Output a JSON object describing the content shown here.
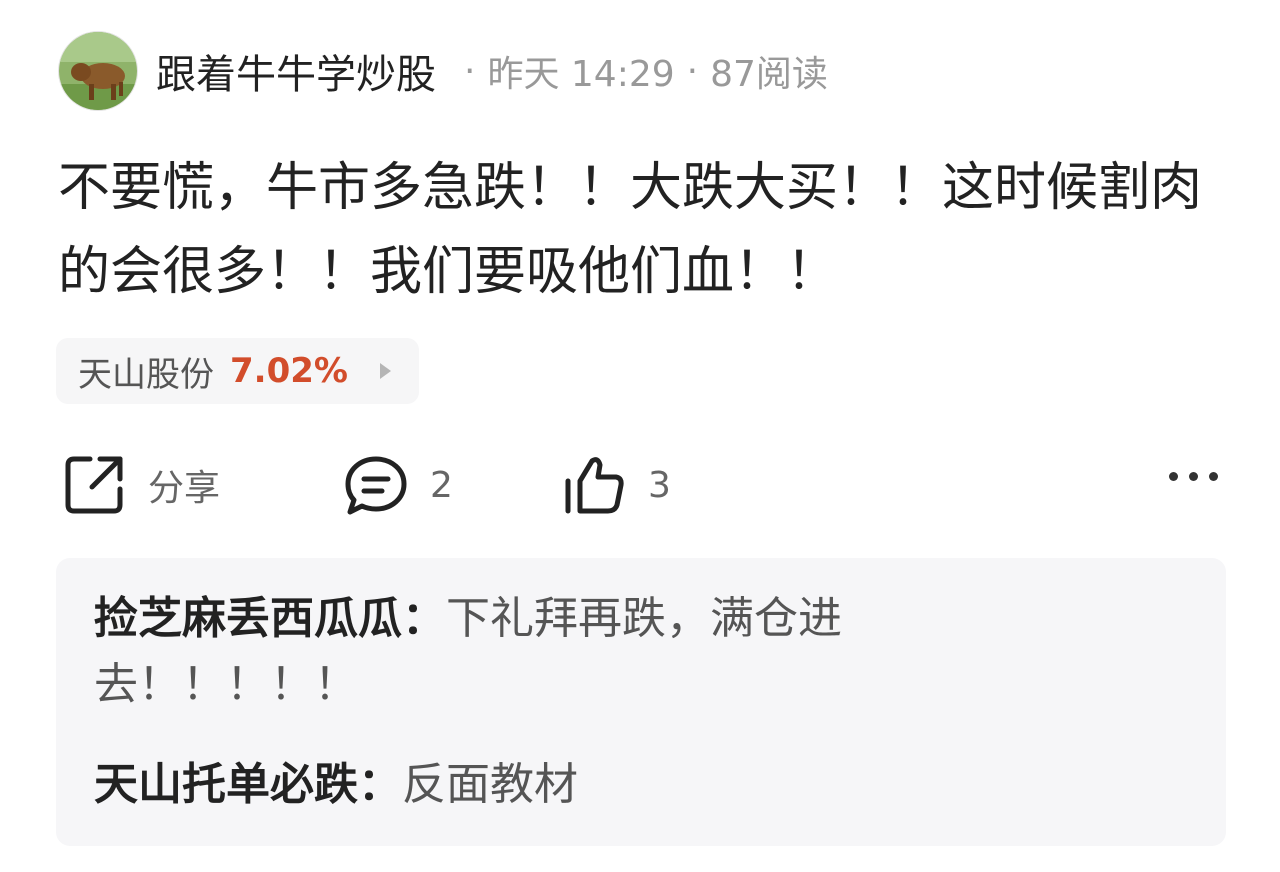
{
  "post": {
    "author": "跟着牛牛学炒股",
    "time": "昨天 14:29",
    "reads": "87阅读",
    "separator": "·",
    "content": "不要慌，牛市多急跌！！大跌大买！！这时候割肉的会很多！！我们要吸他们血！！"
  },
  "stock": {
    "name": "天山股份",
    "change": "7.02%",
    "change_color": "#d24d2b"
  },
  "actions": {
    "share_label": "分享",
    "comment_count": "2",
    "like_count": "3"
  },
  "icons": {
    "share": "share-icon",
    "comment": "comment-bubble-icon",
    "like": "thumbs-up-icon",
    "more": "more-dots-icon",
    "avatar": "bison-avatar"
  },
  "comments": [
    {
      "user": "捡芝麻丢西瓜瓜",
      "colon": "：",
      "text": "下礼拜再跌，满仓进去！！！！！"
    },
    {
      "user": "天山托单必跌",
      "colon": "：",
      "text": "反面教材"
    }
  ]
}
